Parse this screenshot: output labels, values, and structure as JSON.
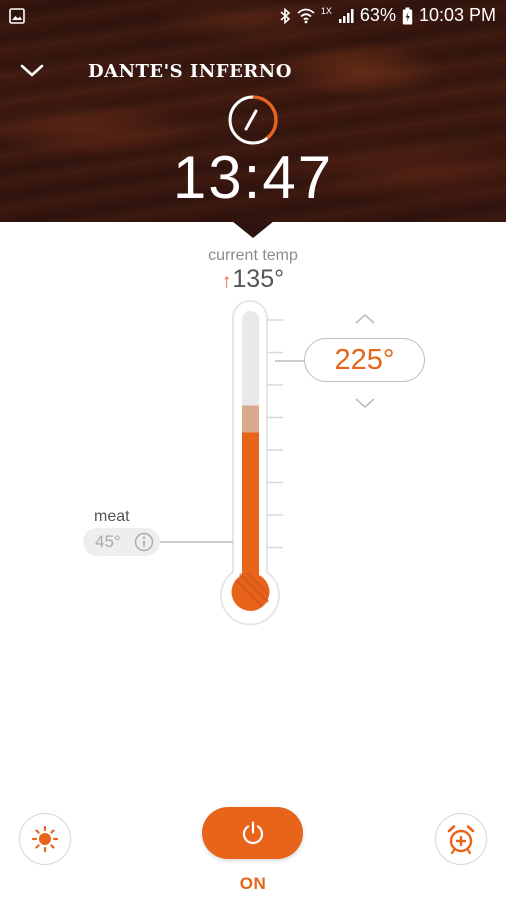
{
  "status_bar": {
    "network_label": "1X",
    "battery_pct": "63%",
    "clock": "10:03 PM"
  },
  "header": {
    "device_name": "DANTE'S INFERNO",
    "timer": "13:47"
  },
  "current_temp": {
    "label": "current temp",
    "value": "135°",
    "trend_arrow": "↑"
  },
  "target_temp": {
    "value": "225°"
  },
  "thermometer": {
    "current_fill_fraction": 0.55,
    "target_fill_fraction": 0.65
  },
  "meat": {
    "label": "meat",
    "value": "45°"
  },
  "controls": {
    "power_label": "ON",
    "left_icon": "sun-icon",
    "center_icon": "power-icon",
    "right_icon": "alarm-add-icon"
  },
  "colors": {
    "accent": "#e8641b",
    "target_band": "#dba98d"
  }
}
